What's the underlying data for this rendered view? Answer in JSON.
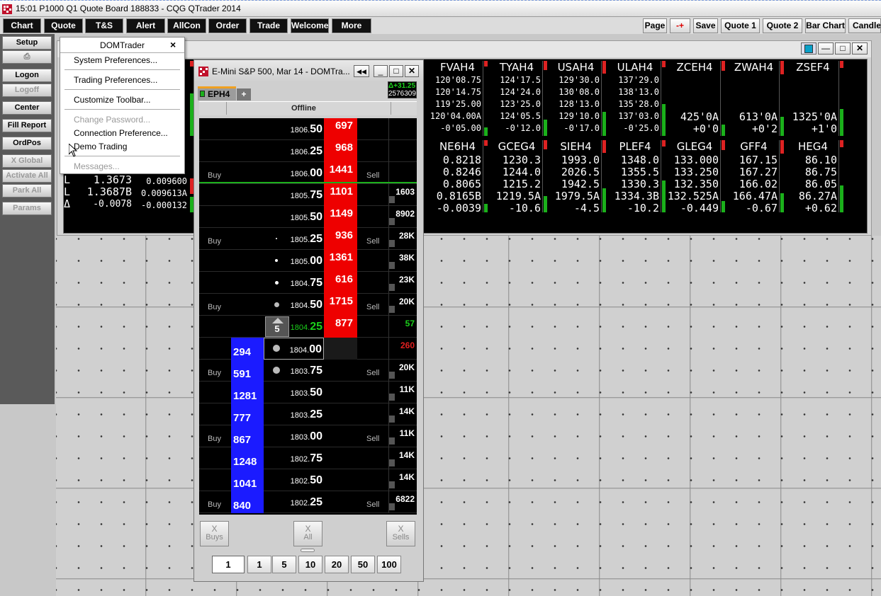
{
  "app": {
    "title": "15:01   P1000 Q1 Quote Board   188833 - CQG QTrader 2014"
  },
  "menubar": [
    "Chart",
    "Quote",
    "T&S",
    "Alert",
    "AllCon",
    "Order",
    "Trade",
    "Welcome",
    "More"
  ],
  "toolbar": {
    "page": "Page",
    "plusminus": "-+",
    "save": "Save",
    "quote1": "Quote 1",
    "quote2": "Quote 2",
    "barchart": "Bar Chart",
    "candle": "Candle"
  },
  "left": {
    "setup": "Setup",
    "logon": "Logon",
    "logoff": "Logoff",
    "center": "Center",
    "fill_report": "Fill Report",
    "ordpos": "OrdPos",
    "xglobal": "X Global",
    "activate_all": "Activate All",
    "park_all": "Park All",
    "params": "Params"
  },
  "menu": {
    "title": "DOMTrader",
    "close": "×",
    "items": [
      "System Preferences...",
      "Trading Preferences...",
      "Customize Toolbar...",
      "Change Password...",
      "Connection Preference...",
      "Demo Trading",
      "Messages..."
    ]
  },
  "quote_top": [
    {
      "name": "FVAH4",
      "lines": [
        "120'08.75",
        "120'14.75",
        "119'25.00",
        "120'04.00A",
        "-0'05.00"
      ]
    },
    {
      "name": "TYAH4",
      "lines": [
        "124'17.5",
        "124'24.0",
        "123'25.0",
        "124'05.5",
        "-0'12.0"
      ]
    },
    {
      "name": "USAH4",
      "lines": [
        "129'30.0",
        "130'08.0",
        "128'13.0",
        "129'10.0",
        "-0'17.0"
      ]
    },
    {
      "name": "ULAH4",
      "lines": [
        "137'29.0",
        "138'13.0",
        "135'28.0",
        "137'03.0",
        "-0'25.0"
      ]
    },
    {
      "name": "ZCEH4",
      "lines": [
        "",
        "",
        "",
        "425'0A",
        "+0'0"
      ]
    },
    {
      "name": "ZWAH4",
      "lines": [
        "",
        "",
        "",
        "613'0A",
        "+0'2"
      ]
    },
    {
      "name": "ZSEF4",
      "lines": [
        "",
        "",
        "",
        "1325'0A",
        "+1'0"
      ]
    }
  ],
  "quote_bot": [
    {
      "name": "NE6H4",
      "lines": [
        "0.8218",
        "0.8246",
        "0.8065",
        "0.8165B",
        "-0.0039"
      ]
    },
    {
      "name": "GCEG4",
      "lines": [
        "1230.3",
        "1244.0",
        "1215.2",
        "1219.5A",
        "-10.6"
      ]
    },
    {
      "name": "SIEH4",
      "lines": [
        "1993.0",
        "2026.5",
        "1942.5",
        "1979.5A",
        "-4.5"
      ]
    },
    {
      "name": "PLEF4",
      "lines": [
        "1348.0",
        "1355.5",
        "1330.3",
        "1334.3B",
        "-10.2"
      ]
    },
    {
      "name": "GLEG4",
      "lines": [
        "133.000",
        "133.250",
        "132.350",
        "132.525A",
        "-0.449"
      ]
    },
    {
      "name": "GFF4",
      "lines": [
        "167.15",
        "167.27",
        "166.02",
        "166.47A",
        "-0.67"
      ]
    },
    {
      "name": "HEG4",
      "lines": [
        "86.10",
        "86.75",
        "86.05",
        "86.27A",
        "+0.62"
      ]
    }
  ],
  "quote_left": {
    "labels": [
      "L",
      "L",
      "Δ"
    ],
    "col1": [
      "1.3673",
      "1.3687B",
      "-0.0078"
    ],
    "col2": [
      "0.009600",
      "0.009613A",
      "-0.000132"
    ]
  },
  "dom": {
    "title": "E-Mini S&P 500, Mar 14 - DOMTra...",
    "tab": "EPH4",
    "add_tab": "+",
    "status": "Offline",
    "delta": "Δ+31.25",
    "volume": "2576309",
    "last_qty": "5",
    "buy": "Buy",
    "sell": "Sell",
    "rows": [
      {
        "p1": "1806.",
        "p2": "50",
        "ask": "697",
        "vol": ""
      },
      {
        "p1": "1806.",
        "p2": "25",
        "ask": "968",
        "vol": ""
      },
      {
        "p1": "1806.",
        "p2": "00",
        "ask": "1441",
        "vol": ""
      },
      {
        "p1": "1805.",
        "p2": "75",
        "ask": "1101",
        "vol": "1603"
      },
      {
        "p1": "1805.",
        "p2": "50",
        "ask": "1149",
        "vol": "8902"
      },
      {
        "p1": "1805.",
        "p2": "25",
        "ask": "936",
        "vol": "28K"
      },
      {
        "p1": "1805.",
        "p2": "00",
        "ask": "1361",
        "vol": "38K"
      },
      {
        "p1": "1804.",
        "p2": "75",
        "ask": "616",
        "vol": "23K"
      },
      {
        "p1": "1804.",
        "p2": "50",
        "ask": "1715",
        "vol": "20K"
      },
      {
        "p1": "1804.",
        "p2": "25",
        "ask": "877",
        "vol": "57"
      },
      {
        "p1": "1804.",
        "p2": "00",
        "bid": "294",
        "vol": "260"
      },
      {
        "p1": "1803.",
        "p2": "75",
        "bid": "591",
        "vol": "20K"
      },
      {
        "p1": "1803.",
        "p2": "50",
        "bid": "1281",
        "vol": "11K"
      },
      {
        "p1": "1803.",
        "p2": "25",
        "bid": "777",
        "vol": "14K"
      },
      {
        "p1": "1803.",
        "p2": "00",
        "bid": "867",
        "vol": "11K"
      },
      {
        "p1": "1802.",
        "p2": "75",
        "bid": "1248",
        "vol": "14K"
      },
      {
        "p1": "1802.",
        "p2": "50",
        "bid": "1041",
        "vol": "14K"
      },
      {
        "p1": "1802.",
        "p2": "25",
        "bid": "840",
        "vol": "6822"
      }
    ],
    "cancel": {
      "x": "X",
      "buys": "Buys",
      "all": "All",
      "sells": "Sells"
    },
    "qty_selected": "1",
    "qty_buttons": [
      "1",
      "5",
      "10",
      "20",
      "50",
      "100"
    ]
  },
  "colors": {
    "ask": "#e00000",
    "bid": "#1b1bff",
    "up": "#1bb01b",
    "down": "#d22222"
  }
}
